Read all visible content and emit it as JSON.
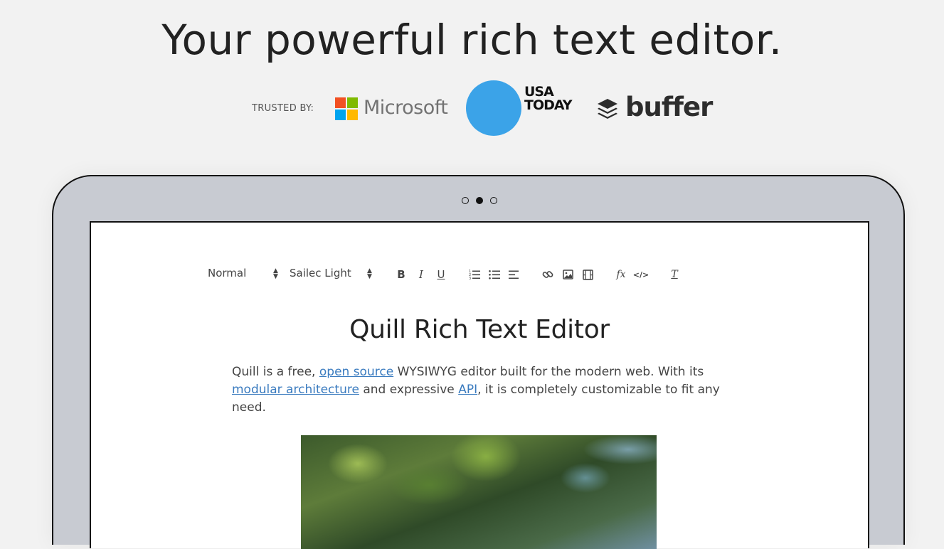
{
  "hero": {
    "headline": "Your powerful rich text editor."
  },
  "trusted": {
    "label": "TRUSTED BY:",
    "logos": {
      "microsoft": {
        "name": "Microsoft",
        "colors": [
          "#f25022",
          "#7fba00",
          "#00a4ef",
          "#ffb900"
        ]
      },
      "usa_today": {
        "line1": "USA",
        "line2": "TODAY",
        "circle_color": "#3ba3e8"
      },
      "buffer": {
        "name": "buffer"
      }
    }
  },
  "carousel": {
    "dots": [
      {
        "active": false
      },
      {
        "active": true
      },
      {
        "active": false
      }
    ]
  },
  "toolbar": {
    "header_select": "Normal",
    "font_select": "Sailec Light",
    "buttons": [
      "bold",
      "italic",
      "underline",
      "ordered-list",
      "bullet-list",
      "align",
      "link",
      "image",
      "video",
      "formula",
      "code-block",
      "clean"
    ]
  },
  "document": {
    "title": "Quill Rich Text Editor",
    "para": {
      "t1": "Quill is a free, ",
      "link1": "open source",
      "t2": " WYSIWYG editor built for the modern web. With its ",
      "link2": "modular architecture",
      "t3": " and expressive ",
      "link3": "API",
      "t4": ", it is completely customizable to fit any need."
    }
  }
}
